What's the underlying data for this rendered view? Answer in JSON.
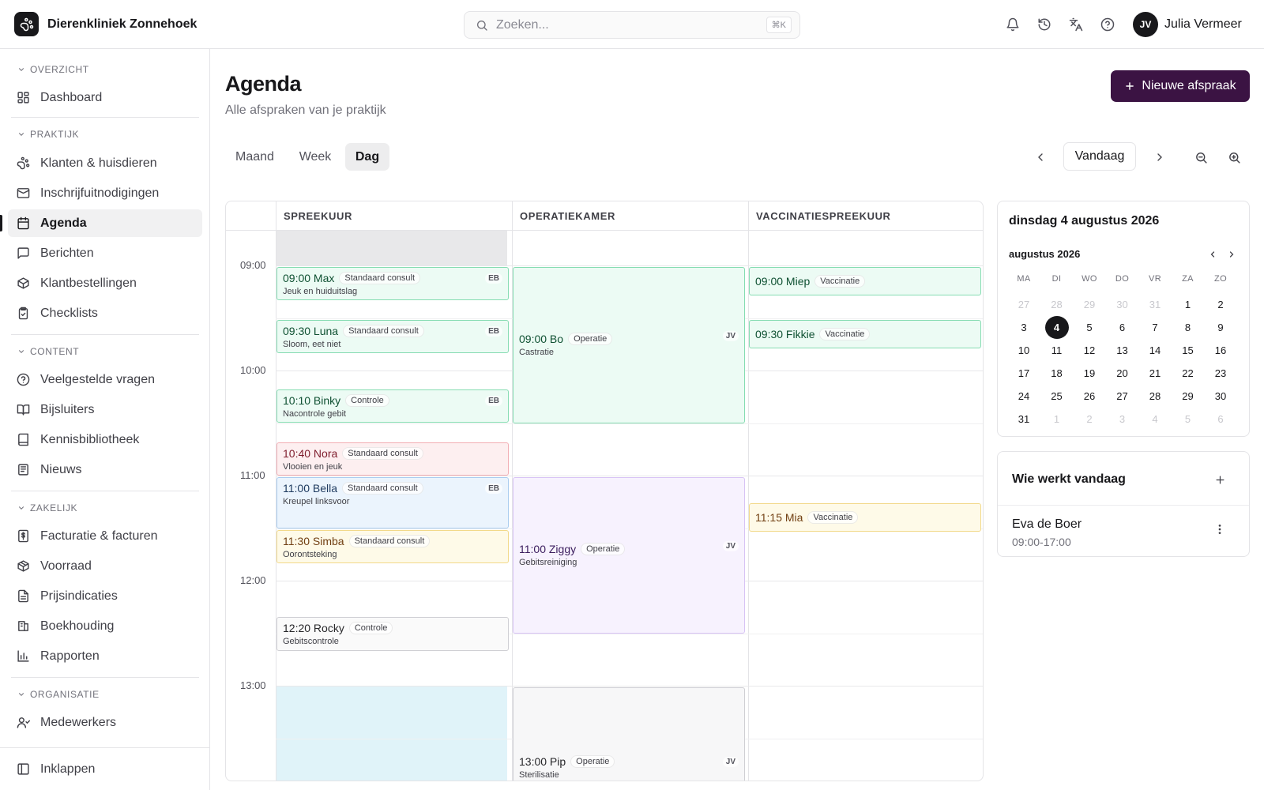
{
  "app": {
    "clinic_name": "Dierenkliniek Zonnehoek"
  },
  "search": {
    "placeholder": "Zoeken...",
    "shortcut": "⌘K"
  },
  "topbar_icons": [
    "bell-icon",
    "history-icon",
    "translate-icon",
    "help-icon"
  ],
  "user": {
    "initials": "JV",
    "name": "Julia Vermeer"
  },
  "sidebar": {
    "sections": [
      {
        "title": "OVERZICHT",
        "items": [
          {
            "label": "Dashboard",
            "icon": "dashboard-icon"
          }
        ]
      },
      {
        "title": "PRAKTIJK",
        "items": [
          {
            "label": "Klanten & huisdieren",
            "icon": "paw-icon"
          },
          {
            "label": "Inschrijfuitnodigingen",
            "icon": "mail-icon"
          },
          {
            "label": "Agenda",
            "icon": "calendar-icon",
            "active": true
          },
          {
            "label": "Berichten",
            "icon": "message-icon"
          },
          {
            "label": "Klantbestellingen",
            "icon": "package-icon"
          },
          {
            "label": "Checklists",
            "icon": "clipboard-icon"
          }
        ]
      },
      {
        "title": "CONTENT",
        "items": [
          {
            "label": "Veelgestelde vragen",
            "icon": "help-circle-icon"
          },
          {
            "label": "Bijsluiters",
            "icon": "book-open-icon"
          },
          {
            "label": "Kennisbibliotheek",
            "icon": "library-icon"
          },
          {
            "label": "Nieuws",
            "icon": "newspaper-icon"
          }
        ]
      },
      {
        "title": "ZAKELIJK",
        "items": [
          {
            "label": "Facturatie & facturen",
            "icon": "invoice-icon"
          },
          {
            "label": "Voorraad",
            "icon": "box-icon"
          },
          {
            "label": "Prijsindicaties",
            "icon": "file-text-icon"
          },
          {
            "label": "Boekhouding",
            "icon": "ledger-icon"
          },
          {
            "label": "Rapporten",
            "icon": "bar-chart-icon"
          }
        ]
      },
      {
        "title": "ORGANISATIE",
        "items": [
          {
            "label": "Medewerkers",
            "icon": "users-icon"
          }
        ]
      }
    ],
    "collapse_label": "Inklappen"
  },
  "page": {
    "title": "Agenda",
    "subtitle": "Alle afspraken van je praktijk",
    "new_button": "Nieuwe afspraak"
  },
  "views": {
    "tabs": [
      "Maand",
      "Week",
      "Dag"
    ],
    "active": "Dag",
    "today_button": "Vandaag"
  },
  "schedule": {
    "columns": [
      "SPREEKUUR",
      "OPERATIEKAMER",
      "VACCINATIESPREEKUUR"
    ],
    "hours": [
      "09:00",
      "10:00",
      "11:00",
      "12:00",
      "13:00"
    ],
    "events": [
      {
        "col": 0,
        "start": "09:00",
        "end": "09:20",
        "time": "09:00",
        "patient": "Max",
        "type": "Standaard consult",
        "note": "Jeuk en huiduitslag",
        "initials": "EB",
        "color": "green"
      },
      {
        "col": 0,
        "start": "09:30",
        "end": "09:50",
        "time": "09:30",
        "patient": "Luna",
        "type": "Standaard consult",
        "note": "Sloom, eet niet",
        "initials": "EB",
        "color": "green"
      },
      {
        "col": 0,
        "start": "10:10",
        "end": "10:30",
        "time": "10:10",
        "patient": "Binky",
        "type": "Controle",
        "note": "Nacontrole gebit",
        "initials": "EB",
        "color": "green"
      },
      {
        "col": 0,
        "start": "10:40",
        "end": "11:00",
        "time": "10:40",
        "patient": "Nora",
        "type": "Standaard consult",
        "note": "Vlooien en jeuk",
        "initials": "",
        "color": "red"
      },
      {
        "col": 0,
        "start": "11:00",
        "end": "11:30",
        "time": "11:00",
        "patient": "Bella",
        "type": "Standaard consult",
        "note": "Kreupel linksvoor",
        "initials": "EB",
        "color": "blue"
      },
      {
        "col": 0,
        "start": "11:30",
        "end": "11:50",
        "time": "11:30",
        "patient": "Simba",
        "type": "Standaard consult",
        "note": "Oorontsteking",
        "initials": "",
        "color": "yellow"
      },
      {
        "col": 0,
        "start": "12:20",
        "end": "12:40",
        "time": "12:20",
        "patient": "Rocky",
        "type": "Controle",
        "note": "Gebitscontrole",
        "initials": "",
        "color": "gray"
      },
      {
        "col": 1,
        "start": "09:00",
        "end": "10:30",
        "time": "09:00",
        "patient": "Bo",
        "type": "Operatie",
        "note": "Castratie",
        "initials": "JV",
        "color": "green"
      },
      {
        "col": 1,
        "start": "11:00",
        "end": "12:30",
        "time": "11:00",
        "patient": "Ziggy",
        "type": "Operatie",
        "note": "Gebitsreiniging",
        "initials": "JV",
        "color": "purple"
      },
      {
        "col": 1,
        "start": "13:00",
        "end": "14:30",
        "time": "13:00",
        "patient": "Pip",
        "type": "Operatie",
        "note": "Sterilisatie",
        "initials": "JV",
        "color": "neutral"
      },
      {
        "col": 2,
        "start": "09:00",
        "end": "09:15",
        "time": "09:00",
        "patient": "Miep",
        "type": "Vaccinatie",
        "note": "",
        "initials": "",
        "color": "green"
      },
      {
        "col": 2,
        "start": "09:30",
        "end": "09:45",
        "time": "09:30",
        "patient": "Fikkie",
        "type": "Vaccinatie",
        "note": "",
        "initials": "",
        "color": "green"
      },
      {
        "col": 2,
        "start": "11:15",
        "end": "11:30",
        "time": "11:15",
        "patient": "Mia",
        "type": "Vaccinatie",
        "note": "",
        "initials": "",
        "color": "yellow"
      }
    ]
  },
  "mini_calendar": {
    "title": "dinsdag 4 augustus 2026",
    "month_label": "augustus 2026",
    "weekdays": [
      "MA",
      "DI",
      "WO",
      "DO",
      "VR",
      "ZA",
      "ZO"
    ],
    "weeks": [
      [
        {
          "d": "27",
          "m": true
        },
        {
          "d": "28",
          "m": true
        },
        {
          "d": "29",
          "m": true
        },
        {
          "d": "30",
          "m": true
        },
        {
          "d": "31",
          "m": true
        },
        {
          "d": "1"
        },
        {
          "d": "2"
        }
      ],
      [
        {
          "d": "3"
        },
        {
          "d": "4",
          "s": true
        },
        {
          "d": "5"
        },
        {
          "d": "6"
        },
        {
          "d": "7"
        },
        {
          "d": "8"
        },
        {
          "d": "9"
        }
      ],
      [
        {
          "d": "10"
        },
        {
          "d": "11"
        },
        {
          "d": "12"
        },
        {
          "d": "13"
        },
        {
          "d": "14"
        },
        {
          "d": "15"
        },
        {
          "d": "16"
        }
      ],
      [
        {
          "d": "17"
        },
        {
          "d": "18"
        },
        {
          "d": "19"
        },
        {
          "d": "20"
        },
        {
          "d": "21"
        },
        {
          "d": "22"
        },
        {
          "d": "23"
        }
      ],
      [
        {
          "d": "24"
        },
        {
          "d": "25"
        },
        {
          "d": "26"
        },
        {
          "d": "27"
        },
        {
          "d": "28"
        },
        {
          "d": "29"
        },
        {
          "d": "30"
        }
      ],
      [
        {
          "d": "31"
        },
        {
          "d": "1",
          "m": true
        },
        {
          "d": "2",
          "m": true
        },
        {
          "d": "3",
          "m": true
        },
        {
          "d": "4",
          "m": true
        },
        {
          "d": "5",
          "m": true
        },
        {
          "d": "6",
          "m": true
        }
      ]
    ]
  },
  "staff_panel": {
    "title": "Wie werkt vandaag",
    "members": [
      {
        "name": "Eva de Boer",
        "hours": "09:00-17:00"
      }
    ]
  },
  "colors": {
    "accent": "#3b1343",
    "dark": "#18181b"
  }
}
